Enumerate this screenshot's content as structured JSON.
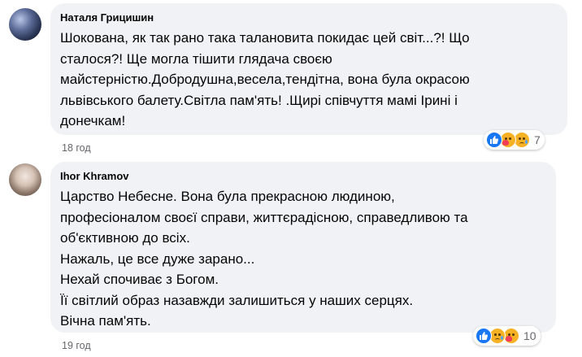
{
  "comments": [
    {
      "author": "Наталя Грицишин",
      "lines": [
        "Шокована, як так рано така талановита покидає цей світ...?! Що",
        "сталося?! Ще могла тішити глядача своєю",
        "майстерністю.Добродушна,весела,тендітна, вона була окрасою",
        "львівського балету.Світла пам'ять! .Щирі співчуття мамі Ірині і",
        "донечкам!"
      ],
      "time": "18 год",
      "reaction_count": "7",
      "reactions": [
        "like-icon",
        "care-icon",
        "sad-icon"
      ]
    },
    {
      "author": "Ihor Khramov",
      "lines": [
        "Царство Небесне. Вона була прекрасною людиною,",
        "професіоналом своєї справи, життєрадісною, справедливою та",
        "об'єктивною до всіх.",
        "Нажаль, це все дуже зарано...",
        "Нехай спочиває з Богом.",
        "Її світлий образ назавжди залишиться у наших серцях.",
        "Вічна пам'ять."
      ],
      "time": "19 год",
      "reaction_count": "10",
      "reactions": [
        "like-icon",
        "sad-icon",
        "care-icon"
      ]
    }
  ],
  "colors": {
    "bubble": "#f0f2f5",
    "secondary_text": "#65676b",
    "like_blue": "#1877f2",
    "emoji_yellow": "#f7b125"
  }
}
